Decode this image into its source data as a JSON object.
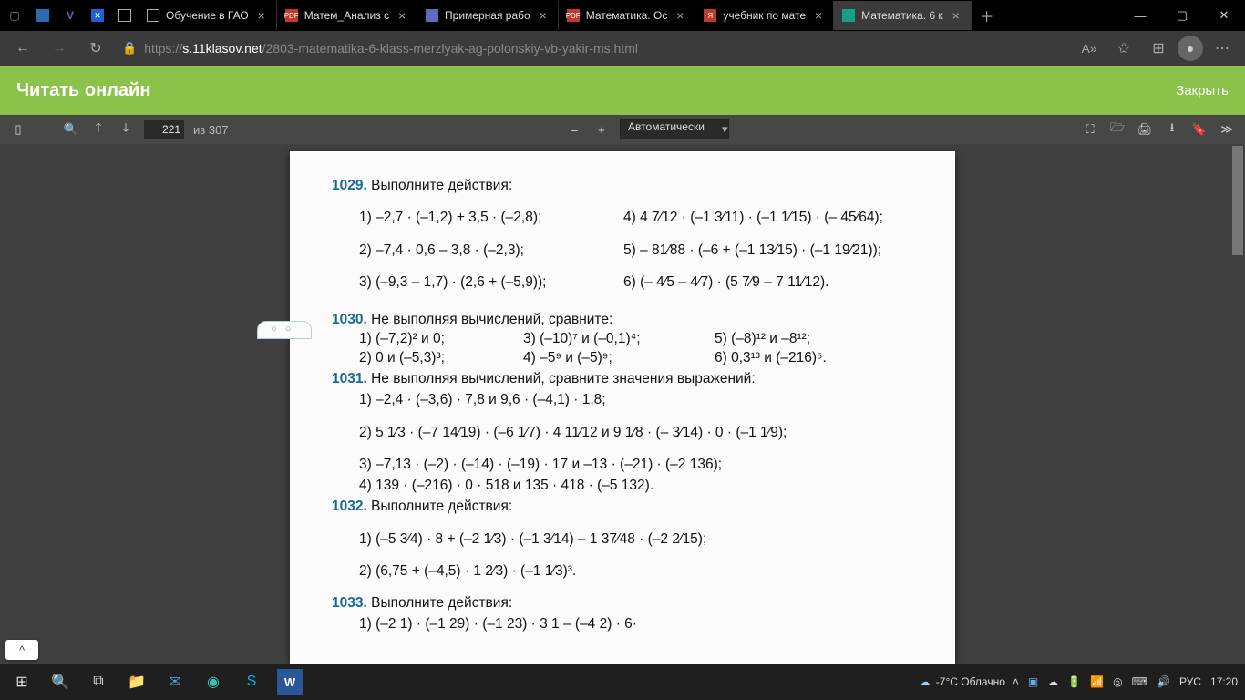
{
  "tabs": [
    {
      "label": "Обучение в ГАО"
    },
    {
      "label": "Матем_Анализ с"
    },
    {
      "label": "Примерная рабо"
    },
    {
      "label": "Математика. Ос"
    },
    {
      "label": "учебник по мате"
    },
    {
      "label": "Математика. 6 к"
    }
  ],
  "url": {
    "host": "s.11klasov.net",
    "path": "/2803-matematika-6-klass-merzlyak-ag-polonskiy-vb-yakir-ms.html",
    "prefix": "https://"
  },
  "greenbar": {
    "title": "Читать онлайн",
    "close": "Закрыть"
  },
  "pdf": {
    "page": "221",
    "of": "из 307",
    "zoom": "Автоматически"
  },
  "weather": {
    "temp": "-7°C Облачно"
  },
  "lang": "РУС",
  "time": "17:20",
  "content": {
    "t1029": "1029.",
    "t1029title": "Выполните действия:",
    "l1029_1": "1) –2,7 · (–1,2) + 3,5 · (–2,8);",
    "l1029_2": "2) –7,4 · 0,6 – 3,8 · (–2,3);",
    "l1029_3": "3) (–9,3 – 1,7) · (2,6 + (–5,9));",
    "l1029_4": "4) 4 7⁄12 · (–1 3⁄11) · (–1 1⁄15) · (– 45⁄64);",
    "l1029_5": "5) – 81⁄88 · (–6 + (–1 13⁄15) · (–1 19⁄21));",
    "l1029_6": "6) (– 4⁄5 – 4⁄7) · (5 7⁄9 – 7 11⁄12).",
    "t1030": "1030.",
    "t1030title": "Не выполняя вычислений, сравните:",
    "l1030_1": "1) (–7,2)² и 0;",
    "l1030_2": "2) 0 и (–5,3)³;",
    "l1030_3": "3) (–10)⁷ и (–0,1)⁴;",
    "l1030_4": "4) –5⁹ и (–5)⁹;",
    "l1030_5": "5) (–8)¹² и –8¹²;",
    "l1030_6": "6) 0,3¹³ и (–216)⁵.",
    "t1031": "1031.",
    "t1031title": "Не выполняя вычислений, сравните значения выражений:",
    "l1031_1": "1) –2,4 · (–3,6) · 7,8 и 9,6 · (–4,1) · 1,8;",
    "l1031_2": "2) 5 1⁄3 · (–7 14⁄19) · (–6 1⁄7) · 4 11⁄12  и  9 1⁄8 · (– 3⁄14) · 0 · (–1 1⁄9);",
    "l1031_3": "3) –7,13 · (–2) · (–14) · (–19) · 17 и –13 · (–21) · (–2 136);",
    "l1031_4": "4) 139 · (–216) · 0 · 518 и 135 · 418 · (–5 132).",
    "t1032": "1032.",
    "t1032title": "Выполните действия:",
    "l1032_1": "1) (–5 3⁄4) · 8 + (–2 1⁄3) · (–1 3⁄14) – 1 37⁄48 · (–2 2⁄15);",
    "l1032_2": "2) (6,75 + (–4,5) · 1 2⁄3) · (–1 1⁄3)³.",
    "t1033": "1033.",
    "t1033title": "Выполните действия:",
    "l1033_1": "1) (–2 1) · (–1 29) · (–1 23) · 3 1  – (–4 2) · 6·"
  }
}
